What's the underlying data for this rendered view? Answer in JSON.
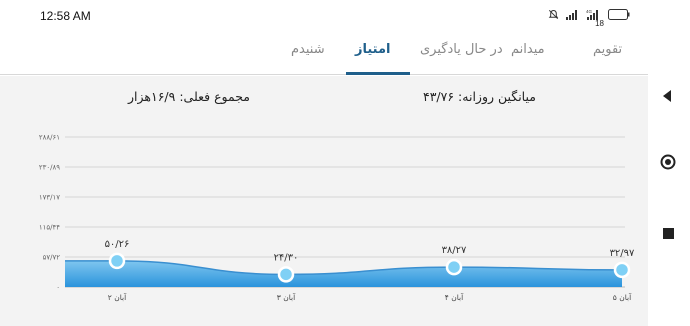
{
  "status_bar": {
    "time": "12:58 AM",
    "battery": "18",
    "icons": [
      "mute-icon",
      "signal-icon",
      "signal-4g-icon",
      "battery-icon"
    ]
  },
  "tabs": [
    {
      "label": "تقویم",
      "active": false
    },
    {
      "label": "میدانم",
      "active": false
    },
    {
      "label": "در حال یادگیری",
      "active": false
    },
    {
      "label": "امتیاز",
      "active": true
    },
    {
      "label": "شنیدم",
      "active": false
    }
  ],
  "summary": {
    "total": "مجموع فعلی: ۱۶/۹هزار",
    "average": "میانگین روزانه: ۴۳/۷۶"
  },
  "chart_data": {
    "type": "area",
    "categories": [
      "۲ آبان",
      "۳ آبان",
      "۴ آبان",
      "۵ آبان"
    ],
    "values": [
      50.26,
      24.3,
      38.27,
      32.97
    ],
    "value_labels": [
      "۵۰/۲۶",
      "۲۴/۳۰",
      "۳۸/۲۷",
      "۳۲/۹۷"
    ],
    "y_ticks": [
      0,
      57.72,
      115.44,
      173.17,
      230.89,
      288.61
    ],
    "y_tick_labels": [
      "۰",
      "۵۷/۷۲",
      "۱۱۵/۴۴",
      "۱۷۳/۱۷",
      "۲۳۰/۸۹",
      "۲۸۸/۶۱"
    ],
    "ylim": [
      0,
      288.61
    ],
    "grid": true,
    "colors": {
      "fill_top": "#7fc6ef",
      "fill_bottom": "#2a93dc",
      "line": "#3a8fd0",
      "marker": "#7fd0f5"
    }
  },
  "nav": {
    "icons": [
      "back-icon",
      "home-icon",
      "recents-icon"
    ]
  }
}
